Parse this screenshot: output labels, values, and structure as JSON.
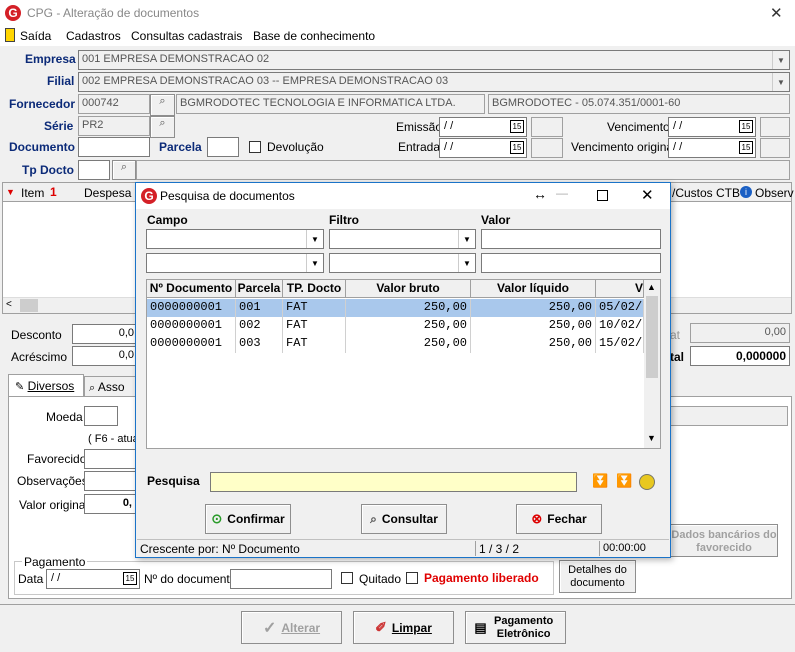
{
  "window": {
    "title": "CPG - Alteração de documentos",
    "close": "✕"
  },
  "menu": {
    "saida": "Saída",
    "cadastros": "Cadastros",
    "consultas": "Consultas cadastrais",
    "base": "Base de conhecimento"
  },
  "form": {
    "empresa_label": "Empresa",
    "empresa_value": "001 EMPRESA DEMONSTRACAO 02",
    "filial_label": "Filial",
    "filial_value": "002 EMPRESA DEMONSTRACAO 03 -- EMPRESA DEMONSTRACAO 03",
    "fornecedor_label": "Fornecedor",
    "fornecedor_code": "000742",
    "fornecedor_name": "BGMRODOTEC TECNOLOGIA E INFORMATICA LTDA.",
    "fornecedor_cnpj": "BGMRODOTEC - 05.074.351/0001-60",
    "serie_label": "Série",
    "serie_value": "PR2",
    "documento_label": "Documento",
    "parcela_label": "Parcela",
    "devolucao_label": "Devolução",
    "tpdocto_label": "Tp Docto",
    "emissao_label": "Emissão",
    "entrada_label": "Entrada",
    "vencimento_label": "Vencimento",
    "venc_original_label": "Vencimento original",
    "date_empty": " / /",
    "cal_glyph": "15"
  },
  "grid": {
    "item": "Item",
    "item_num": "1",
    "despesa": "Despesa",
    "custos": "/Custos CTB",
    "observ": "Observ"
  },
  "totals": {
    "desconto": "Desconto",
    "desconto_val": "0,0",
    "acrescimo": "Acréscimo",
    "acrescimo_val": "0,0",
    "right_label1": "at",
    "right_val1": "0,00",
    "right_label2": "tal",
    "right_val2": "0,000000"
  },
  "tabs": {
    "diversos": "Diversos",
    "assoc": "Asso"
  },
  "diversos": {
    "moeda": "Moeda",
    "f6": "( F6 - atual",
    "favorecido": "Favorecido",
    "observacoes": "Observações",
    "valor_original": "Valor original",
    "valor_original_val": "0,"
  },
  "pagamento": {
    "legend": "Pagamento",
    "data": "Data",
    "data_val": " / /",
    "ndoc": "Nº do documento",
    "quitado": "Quitado",
    "liberado": "Pagamento liberado",
    "detalhes": "Detalhes do documento",
    "dados_bancarios": "Dados bancários do favorecido"
  },
  "footer": {
    "alterar": "Alterar",
    "limpar": "Limpar",
    "pagamento_eletronico": "Pagamento Eletrônico"
  },
  "dialog": {
    "title": "Pesquisa de documentos",
    "campo": "Campo",
    "filtro": "Filtro",
    "valor": "Valor",
    "columns": [
      "Nº Documento",
      "Parcela",
      "TP. Docto",
      "Valor bruto",
      "Valor líquido",
      "V"
    ],
    "rows": [
      [
        "0000000001",
        "001",
        "FAT",
        "250,00",
        "250,00",
        "05/02/"
      ],
      [
        "0000000001",
        "002",
        "FAT",
        "250,00",
        "250,00",
        "10/02/"
      ],
      [
        "0000000001",
        "003",
        "FAT",
        "250,00",
        "250,00",
        "15/02/"
      ]
    ],
    "pesquisa": "Pesquisa",
    "confirmar": "Confirmar",
    "consultar": "Consultar",
    "fechar": "Fechar",
    "status_order": "Crescente por: Nº Documento",
    "status_count": "1 / 3 / 2",
    "status_time": "00:00:00"
  },
  "colors": {
    "accent_label": "#0b2a78",
    "selected_row": "#a9c8ec",
    "red": "#e00000",
    "pesquisa_bg": "#ffffc8"
  }
}
